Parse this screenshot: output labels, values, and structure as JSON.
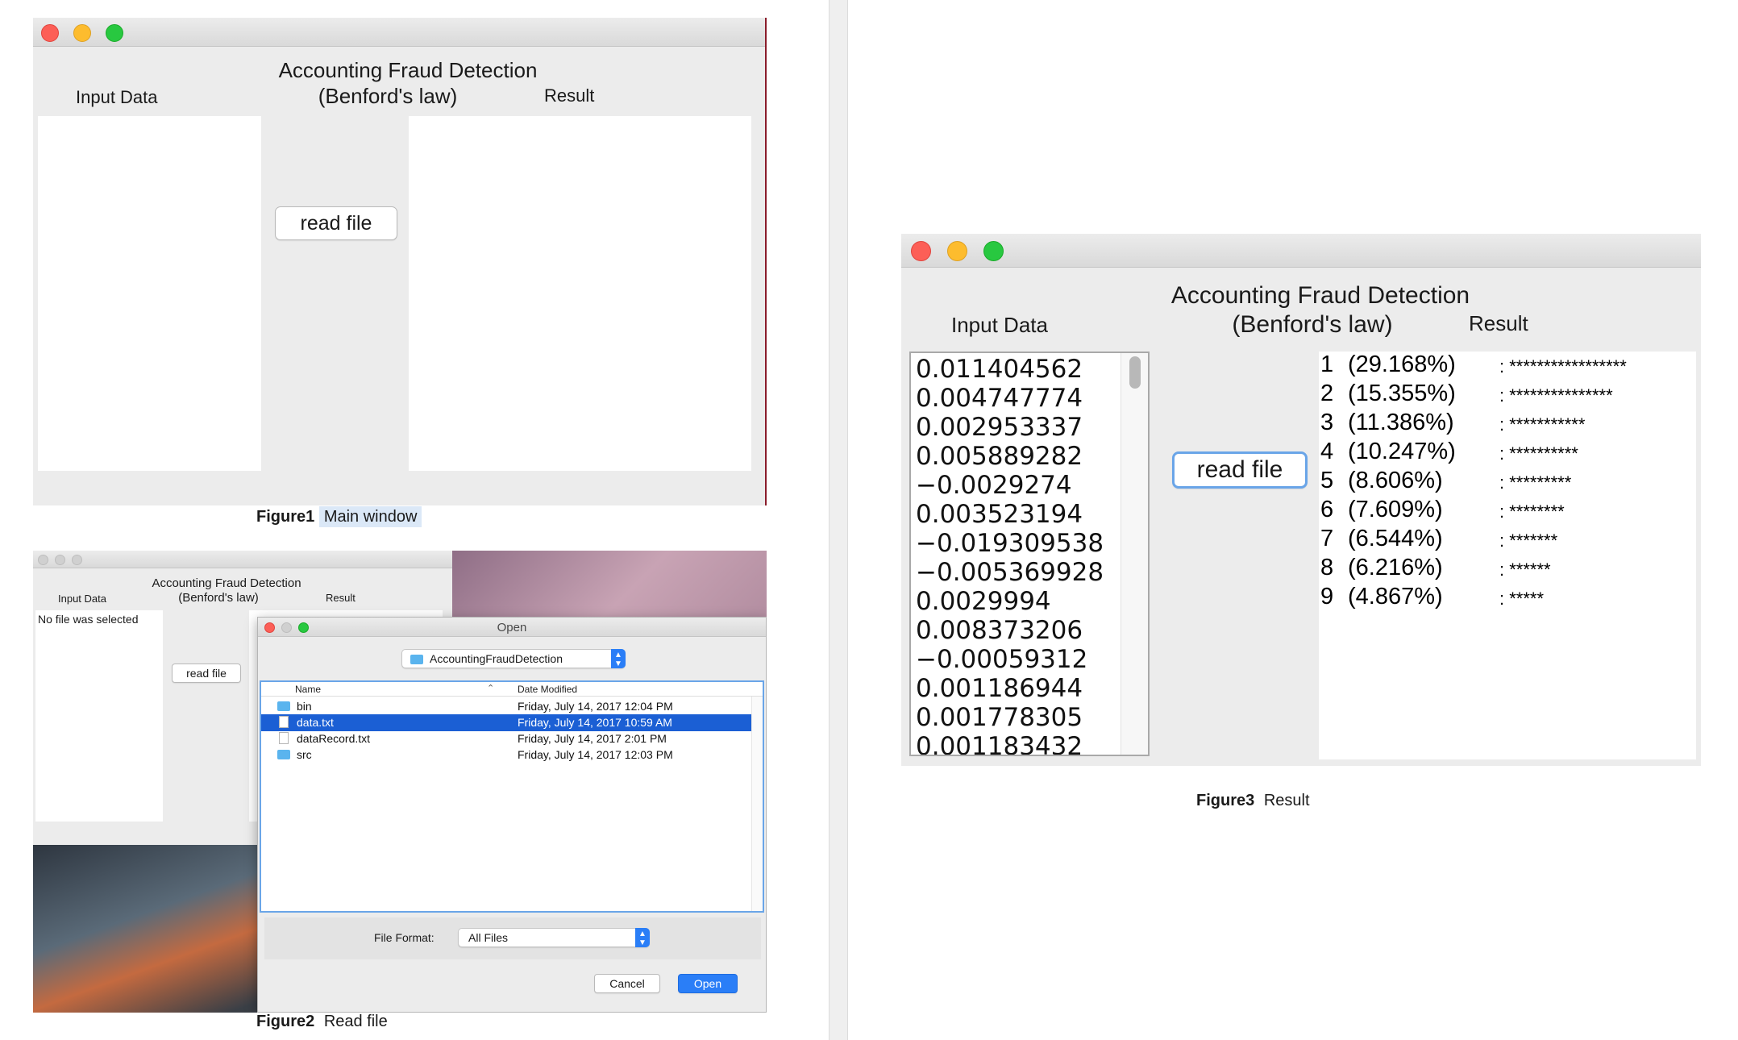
{
  "app": {
    "title_line1": "Accounting Fraud Detection",
    "title_line2": "(Benford's law)",
    "input_label": "Input Data",
    "result_label": "Result",
    "read_button": "read file"
  },
  "figure1": {
    "caption_bold": "Figure1",
    "caption_text": "Main window"
  },
  "figure2": {
    "caption_bold": "Figure2",
    "caption_text": "Read file",
    "input_status": "No file was selected",
    "dialog": {
      "title": "Open",
      "folder": "AccountingFraudDetection",
      "col_name": "Name",
      "col_date": "Date Modified",
      "files": [
        {
          "name": "bin",
          "date": "Friday, July 14, 2017 12:04 PM",
          "icon": "folder-icon",
          "selected": false
        },
        {
          "name": "data.txt",
          "date": "Friday, July 14, 2017 10:59 AM",
          "icon": "document-icon",
          "selected": true
        },
        {
          "name": "dataRecord.txt",
          "date": "Friday, July 14, 2017 2:01 PM",
          "icon": "document-icon",
          "selected": false
        },
        {
          "name": "src",
          "date": "Friday, July 14, 2017 12:03 PM",
          "icon": "folder-icon",
          "selected": false
        }
      ],
      "format_label": "File Format:",
      "format_value": "All Files",
      "cancel": "Cancel",
      "open": "Open"
    }
  },
  "figure3": {
    "caption_bold": "Figure3",
    "caption_text": "Result",
    "input_values": [
      "0.011404562",
      "0.004747774",
      "0.002953337",
      "0.005889282",
      "−0.0029274",
      "0.003523194",
      "−0.019309538",
      "−0.005369928",
      "0.0029994",
      "0.008373206",
      "−0.00059312",
      "0.001186944",
      "0.001778305",
      "0.001183432"
    ],
    "results": [
      {
        "digit": "1",
        "pct": "(29.168%)",
        "bar": ":  *****************"
      },
      {
        "digit": "2",
        "pct": "(15.355%)",
        "bar": ":  ***************"
      },
      {
        "digit": "3",
        "pct": "(11.386%)",
        "bar": ":  ***********"
      },
      {
        "digit": "4",
        "pct": "(10.247%)",
        "bar": ":  **********"
      },
      {
        "digit": "5",
        "pct": "(8.606%)",
        "bar": ":  *********"
      },
      {
        "digit": "6",
        "pct": "(7.609%)",
        "bar": ":  ********"
      },
      {
        "digit": "7",
        "pct": "(6.544%)",
        "bar": ":  *******"
      },
      {
        "digit": "8",
        "pct": "(6.216%)",
        "bar": ":  ******"
      },
      {
        "digit": "9",
        "pct": "(4.867%)",
        "bar": ":  *****"
      }
    ]
  },
  "colors": {
    "window_bg": "#ececec",
    "selection_blue": "#1b5fd4",
    "caption_highlight": "#dbe8f7"
  }
}
